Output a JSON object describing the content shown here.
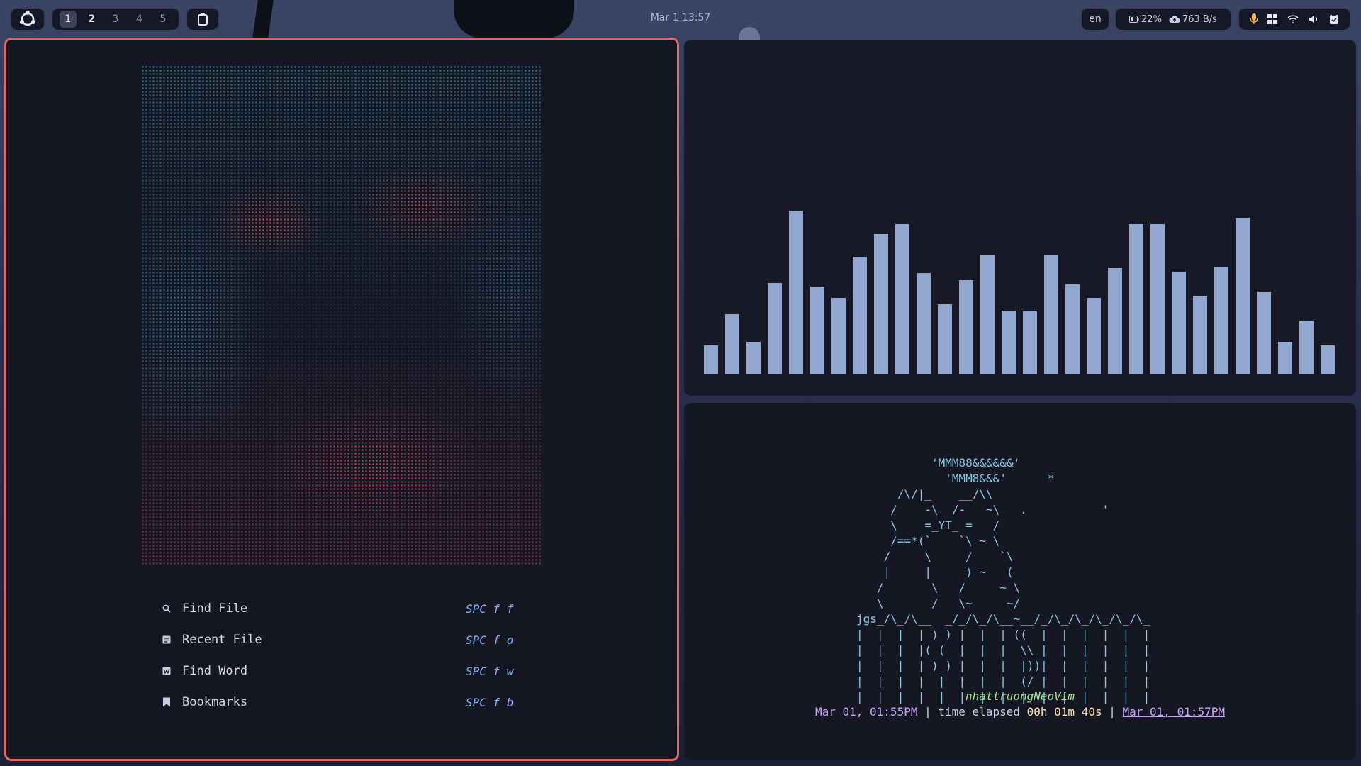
{
  "topbar": {
    "logo_icon": "distro-logo-icon",
    "workspaces": [
      {
        "label": "1",
        "state": "active"
      },
      {
        "label": "2",
        "state": "occupied"
      },
      {
        "label": "3",
        "state": "empty"
      },
      {
        "label": "4",
        "state": "empty"
      },
      {
        "label": "5",
        "state": "empty"
      }
    ],
    "clipboard_icon": "clipboard-icon",
    "clock": "Mar 1  13:57",
    "language": "en",
    "battery": "22%",
    "network_speed": "763 B/s",
    "tray_icons": [
      "microphone-icon",
      "grid-icon",
      "wifi-icon",
      "volume-icon",
      "clipboard-check-icon"
    ]
  },
  "dashboard": {
    "items": [
      {
        "icon": "search-icon",
        "label": "Find File",
        "key": "SPC f f"
      },
      {
        "icon": "file-icon",
        "label": "Recent File",
        "key": "SPC f o"
      },
      {
        "icon": "word-icon",
        "label": "Find Word",
        "key": "SPC f w"
      },
      {
        "icon": "bookmark-icon",
        "label": "Bookmarks",
        "key": "SPC f b"
      }
    ]
  },
  "visualizer": {
    "color": "#93a8d0",
    "levels": [
      0.18,
      0.37,
      0.2,
      0.56,
      1.0,
      0.54,
      0.47,
      0.72,
      0.86,
      0.92,
      0.62,
      0.43,
      0.58,
      0.73,
      0.39,
      0.39,
      0.73,
      0.55,
      0.47,
      0.65,
      0.92,
      0.92,
      0.63,
      0.48,
      0.66,
      0.96,
      0.51,
      0.2,
      0.33,
      0.18
    ]
  },
  "ascii_art": {
    "lines": [
      "           'MMM88&&&&&&'",
      "             'MMM8&&&'      *",
      "      /\\/|_    __/\\\\",
      "     /    -\\  /-   ~\\   .           '",
      "     \\    =_YT_ =   /",
      "     /==*(`    `\\ ~ \\",
      "    /     \\     /    `\\",
      "    |     |     ) ~   (",
      "   /       \\   /     ~ \\",
      "   \\       /   \\~     ~/",
      "jgs_/\\_/\\__  _/_/\\_/\\__~__/_/\\_/\\_/\\_/\\_/\\_",
      "|  |  |  | ) ) |  |  | ((  |  |  |  |  |  |",
      "|  |  |  |( (  |  |  |  \\\\ |  |  |  |  |  |",
      "|  |  |  | )_) |  |  |  |))|  |  |  |  |  |",
      "|  |  |  |  |  |  |  |  (/ |  |  |  |  |  |",
      "|  |  |  |  |  |  |  |  |  |  |  |  |  |  |"
    ],
    "author": "nhattruongNeoVim",
    "start_time": "Mar 01, 01:55PM",
    "elapsed_label": "time elapsed",
    "elapsed": "00h 01m 40s",
    "end_time": "Mar 01, 01:57PM",
    "separator": "|"
  }
}
